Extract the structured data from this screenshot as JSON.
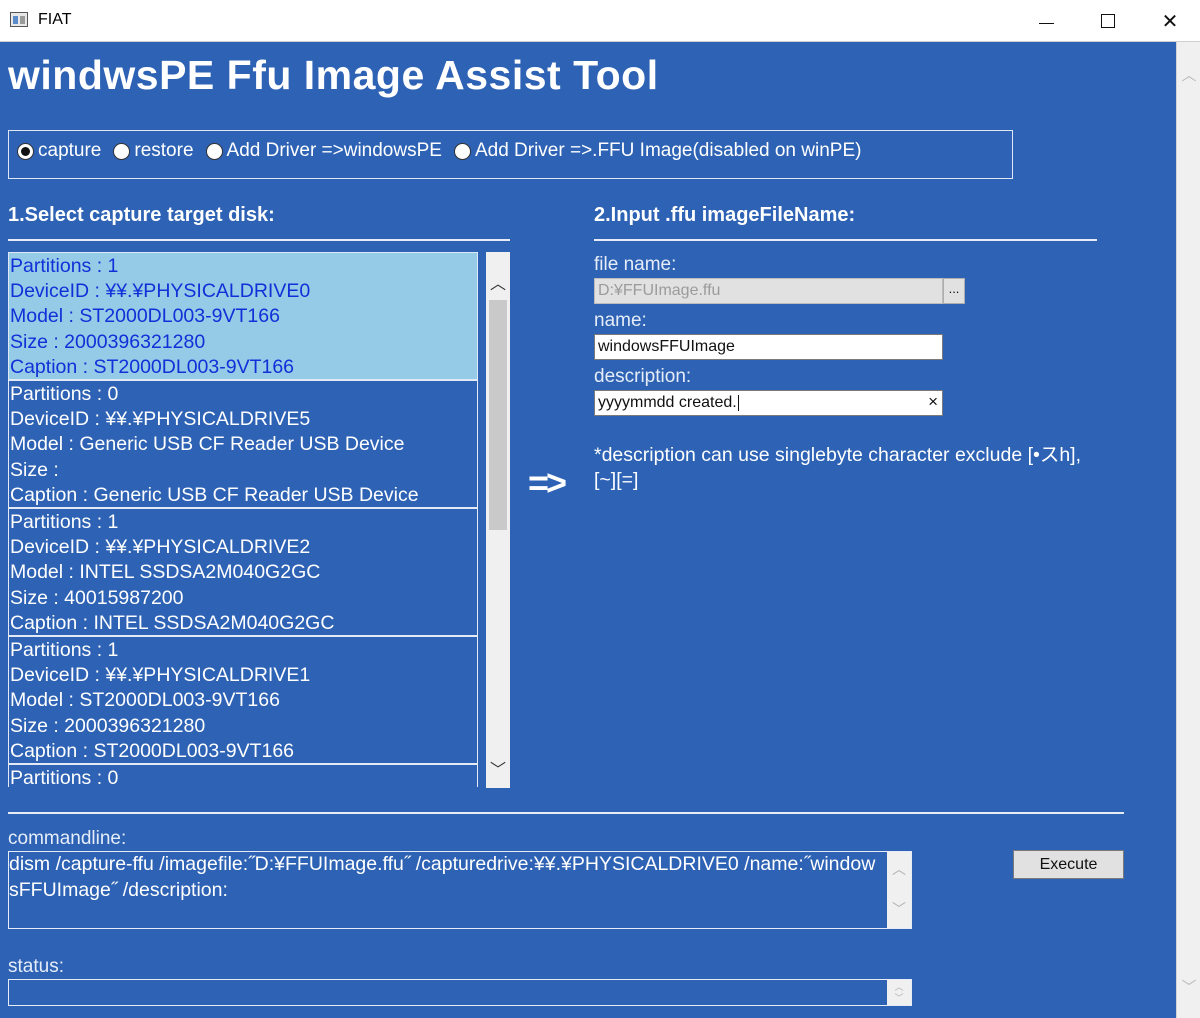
{
  "window": {
    "title": "FIAT"
  },
  "app": {
    "title": "windwsPE Ffu Image Assist Tool"
  },
  "modes": [
    {
      "label": "capture",
      "selected": true
    },
    {
      "label": "restore",
      "selected": false
    },
    {
      "label": "Add Driver =>windowsPE",
      "selected": false
    },
    {
      "label": "Add Driver =>.FFU Image(disabled on winPE)",
      "selected": false
    }
  ],
  "section1": {
    "label": "1.Select capture target disk:"
  },
  "section2": {
    "label": "2.Input .ffu imageFileName:"
  },
  "disks": [
    {
      "selected": true,
      "lines": [
        "Partitions : 1",
        "DeviceID : ¥¥.¥PHYSICALDRIVE0",
        "Model : ST2000DL003-9VT166",
        "Size : 2000396321280",
        "Caption : ST2000DL003-9VT166"
      ]
    },
    {
      "selected": false,
      "lines": [
        "Partitions : 0",
        "DeviceID : ¥¥.¥PHYSICALDRIVE5",
        "Model : Generic USB CF Reader USB Device",
        "Size : ",
        "Caption : Generic USB CF Reader USB Device"
      ]
    },
    {
      "selected": false,
      "lines": [
        "Partitions : 1",
        "DeviceID : ¥¥.¥PHYSICALDRIVE2",
        "Model : INTEL SSDSA2M040G2GC",
        "Size : 40015987200",
        "Caption : INTEL SSDSA2M040G2GC"
      ]
    },
    {
      "selected": false,
      "lines": [
        "Partitions : 1",
        "DeviceID : ¥¥.¥PHYSICALDRIVE1",
        "Model : ST2000DL003-9VT166",
        "Size : 2000396321280",
        "Caption : ST2000DL003-9VT166"
      ]
    },
    {
      "selected": false,
      "lines": [
        "Partitions : 0"
      ]
    }
  ],
  "arrow": "=>",
  "form": {
    "file_name_label": "file name:",
    "file_name_value": "D:¥FFUImage.ffu",
    "browse_label": "...",
    "name_label": "name:",
    "name_value": "windowsFFUImage",
    "description_label": "description:",
    "description_value": "yyyymmdd created.",
    "clear_label": "×",
    "note": "*description can use singlebyte character exclude [•スh],[~][=]"
  },
  "commandline": {
    "label": "commandline:",
    "value": "dism /capture-ffu /imagefile:˝D:¥FFUImage.ffu˝ /capturedrive:¥¥.¥PHYSICALDRIVE0 /name:˝windowsFFUImage˝ /description:"
  },
  "execute": {
    "label": "Execute"
  },
  "status": {
    "label": "status:",
    "value": ""
  }
}
